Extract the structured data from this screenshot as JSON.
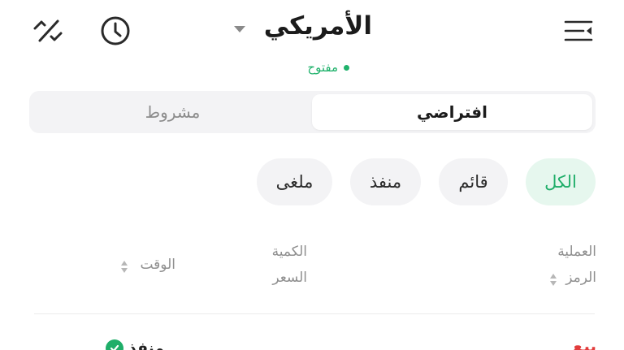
{
  "header": {
    "menu_icon": "menu-collapse-icon",
    "history_icon": "clock-icon",
    "switch_icon": "slash-switch-icon",
    "market_title": "الأمريكي",
    "market_status": "مفتوح",
    "status_color": "#20b26c"
  },
  "segment": {
    "default_label": "افتراضي",
    "conditional_label": "مشروط",
    "selected": "افتراضي"
  },
  "filters": {
    "all": "الكل",
    "active": "قائم",
    "executed": "منفذ",
    "cancelled": "ملغى",
    "selected": "الكل",
    "accent": "#1fae69"
  },
  "table": {
    "headers": {
      "operation": "العملية",
      "symbol": "الرمز",
      "quantity": "الكمية",
      "price": "السعر",
      "time": "الوقت"
    },
    "rows": [
      {
        "status": "منفذ",
        "operation": "بيع"
      }
    ]
  }
}
